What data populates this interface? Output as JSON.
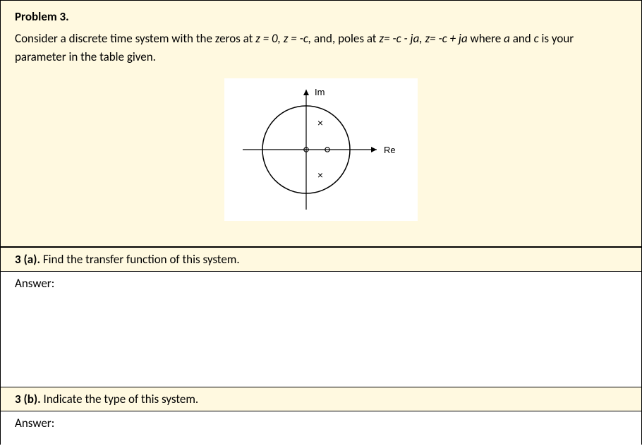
{
  "problem": {
    "title": "Problem 3.",
    "text_part1": "Consider a discrete time system with the zeros at ",
    "eq1": "z = 0, z = -c,",
    "text_part2": " and, poles at ",
    "eq2": "z= -c - ja, z= -c + ja",
    "text_part3": " where  ",
    "var_a": "a",
    "text_part4": " and ",
    "var_c": "c",
    "text_part5": " is your parameter in the table given."
  },
  "diagram": {
    "axis_im": "Im",
    "axis_re": "Re",
    "marker_pole": "×",
    "marker_zero": "o"
  },
  "q_a": {
    "label": "3 (a).",
    "text": " Find the transfer function of this system."
  },
  "q_b": {
    "label": "3 (b).",
    "text": " Indicate the type of this system."
  },
  "answer_label": "Answer:",
  "chart_data": {
    "type": "pole-zero-plot",
    "title": "",
    "xlabel": "Re",
    "ylabel": "Im",
    "unit_circle": true,
    "zeros": [
      {
        "re": 0,
        "im": 0,
        "label": "z=0"
      },
      {
        "re": 0.35,
        "im": 0,
        "label": "z=-c (shown on positive real axis in figure)"
      }
    ],
    "poles": [
      {
        "re": 0.25,
        "im": 0.35,
        "label": "z=-c+ja"
      },
      {
        "re": 0.25,
        "im": -0.35,
        "label": "z=-c-ja"
      }
    ],
    "xlim": [
      -1.5,
      1.5
    ],
    "ylim": [
      -1.5,
      1.5
    ]
  }
}
